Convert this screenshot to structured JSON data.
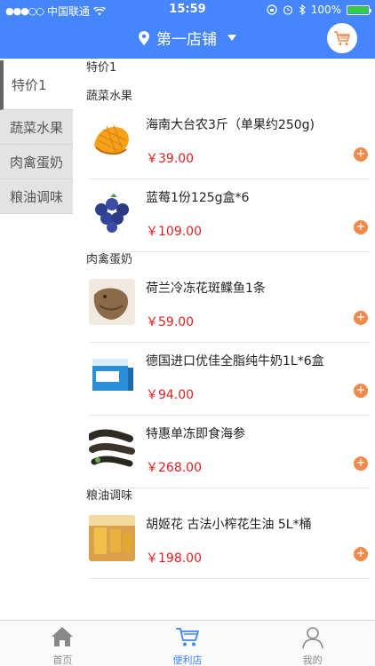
{
  "status_bar": {
    "carrier": "中国联通",
    "time": "15:59",
    "battery": "100%",
    "battery_level": 1.0
  },
  "header": {
    "title": "第一店铺"
  },
  "sidebar": {
    "items": [
      {
        "label": "特价1",
        "active": true
      },
      {
        "label": "蔬菜水果",
        "active": false
      },
      {
        "label": "肉禽蛋奶",
        "active": false
      },
      {
        "label": "粮油调味",
        "active": false
      }
    ]
  },
  "content": {
    "top_label": "特价1",
    "sections": [
      {
        "title": "蔬菜水果",
        "products": [
          {
            "name": "海南大台农3斤（单果约250g)",
            "price": "￥39.00",
            "image_icon": "mango-image"
          },
          {
            "name": "蓝莓1份125g盒*6",
            "price": "￥109.00",
            "image_icon": "blueberry-image"
          }
        ]
      },
      {
        "title": "肉禽蛋奶",
        "products": [
          {
            "name": "荷兰冷冻花斑鲽鱼1条",
            "price": "￥59.00",
            "image_icon": "fish-image"
          },
          {
            "name": "德国进口优佳全脂纯牛奶1L*6盒",
            "price": "￥94.00",
            "image_icon": "milk-box-image"
          },
          {
            "name": "特惠单冻即食海参",
            "price": "￥268.00",
            "image_icon": "sea-cucumber-image"
          }
        ]
      },
      {
        "title": "粮油调味",
        "products": [
          {
            "name": "胡姬花 古法小榨花生油 5L*桶",
            "price": "￥198.00",
            "image_icon": "peanut-oil-image"
          }
        ]
      }
    ]
  },
  "tabbar": {
    "items": [
      {
        "label": "首页",
        "icon": "home-icon",
        "active": false
      },
      {
        "label": "便利店",
        "icon": "cart-icon",
        "active": true
      },
      {
        "label": "我的",
        "icon": "person-icon",
        "active": false
      }
    ]
  },
  "colors": {
    "brand": "#4586ff",
    "price": "#e02020",
    "add": "#f08a4b",
    "active_tab": "#3d86ff"
  }
}
